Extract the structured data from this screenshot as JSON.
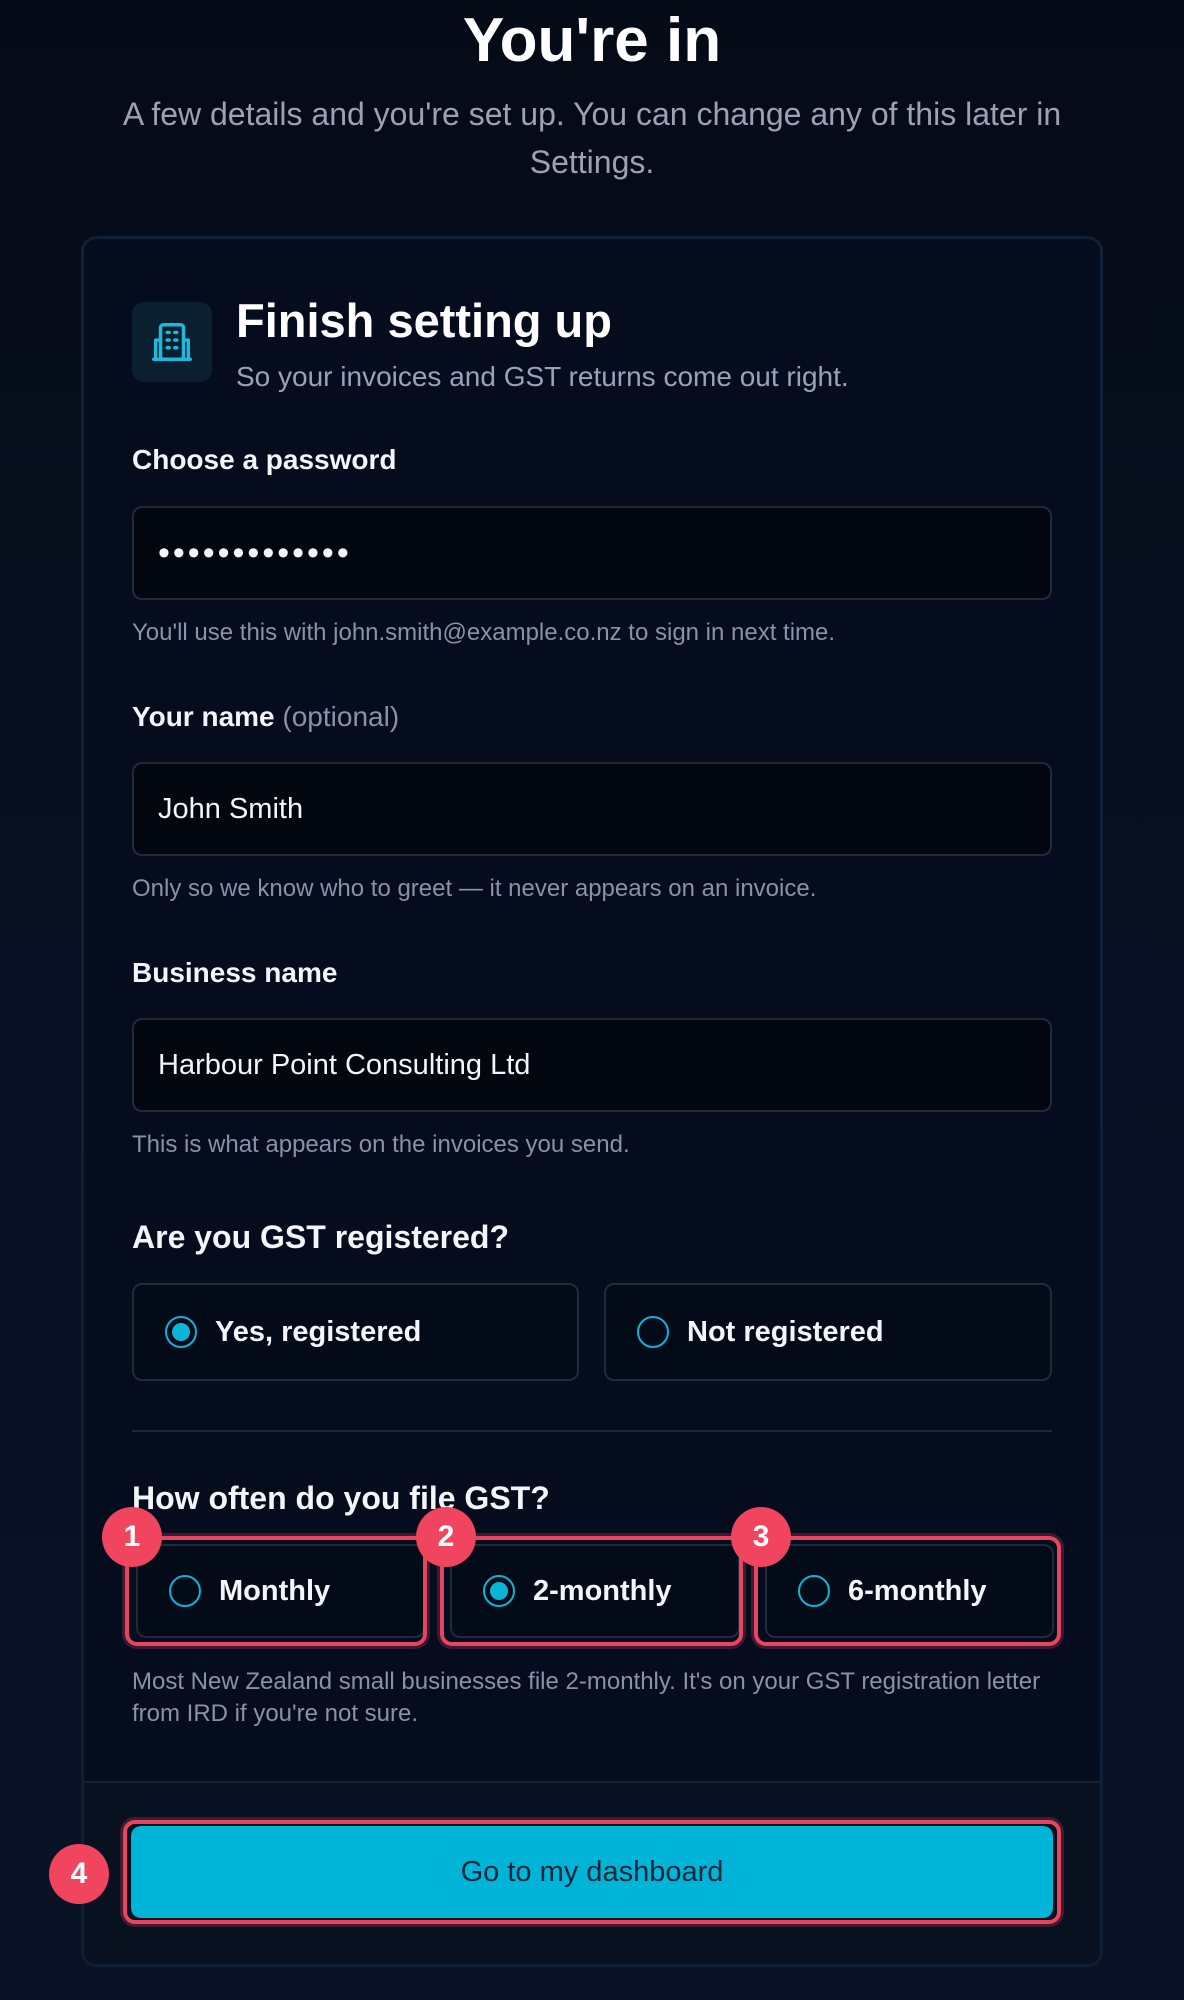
{
  "header": {
    "title": "You're in",
    "subtitle": "A few details and you're set up. You can change any of this later in Settings."
  },
  "card": {
    "icon": "building-icon",
    "title": "Finish setting up",
    "subtitle": "So your invoices and GST returns come out right."
  },
  "password": {
    "label": "Choose a password",
    "value": "•••••••••••••",
    "help": "You'll use this with john.smith@example.co.nz to sign in next time."
  },
  "name": {
    "label": "Your name",
    "optional": "(optional)",
    "value": "John Smith",
    "help": "Only so we know who to greet — it never appears on an invoice."
  },
  "business": {
    "label": "Business name",
    "value": "Harbour Point Consulting Ltd",
    "help": "This is what appears on the invoices you send."
  },
  "gst_registered": {
    "heading": "Are you GST registered?",
    "options": [
      {
        "label": "Yes, registered",
        "selected": true
      },
      {
        "label": "Not registered",
        "selected": false
      }
    ]
  },
  "gst_frequency": {
    "heading": "How often do you file GST?",
    "options": [
      {
        "label": "Monthly",
        "selected": false
      },
      {
        "label": "2-monthly",
        "selected": true
      },
      {
        "label": "6-monthly",
        "selected": false
      }
    ],
    "help": "Most New Zealand small businesses file 2-monthly. It's on your GST registration letter from IRD if you're not sure."
  },
  "footer": {
    "button_label": "Go to my dashboard"
  },
  "annotations": {
    "badges": [
      "1",
      "2",
      "3",
      "4"
    ]
  },
  "colors": {
    "accent": "#00b4d8",
    "highlight": "#e8435f",
    "background": "#050b16"
  }
}
